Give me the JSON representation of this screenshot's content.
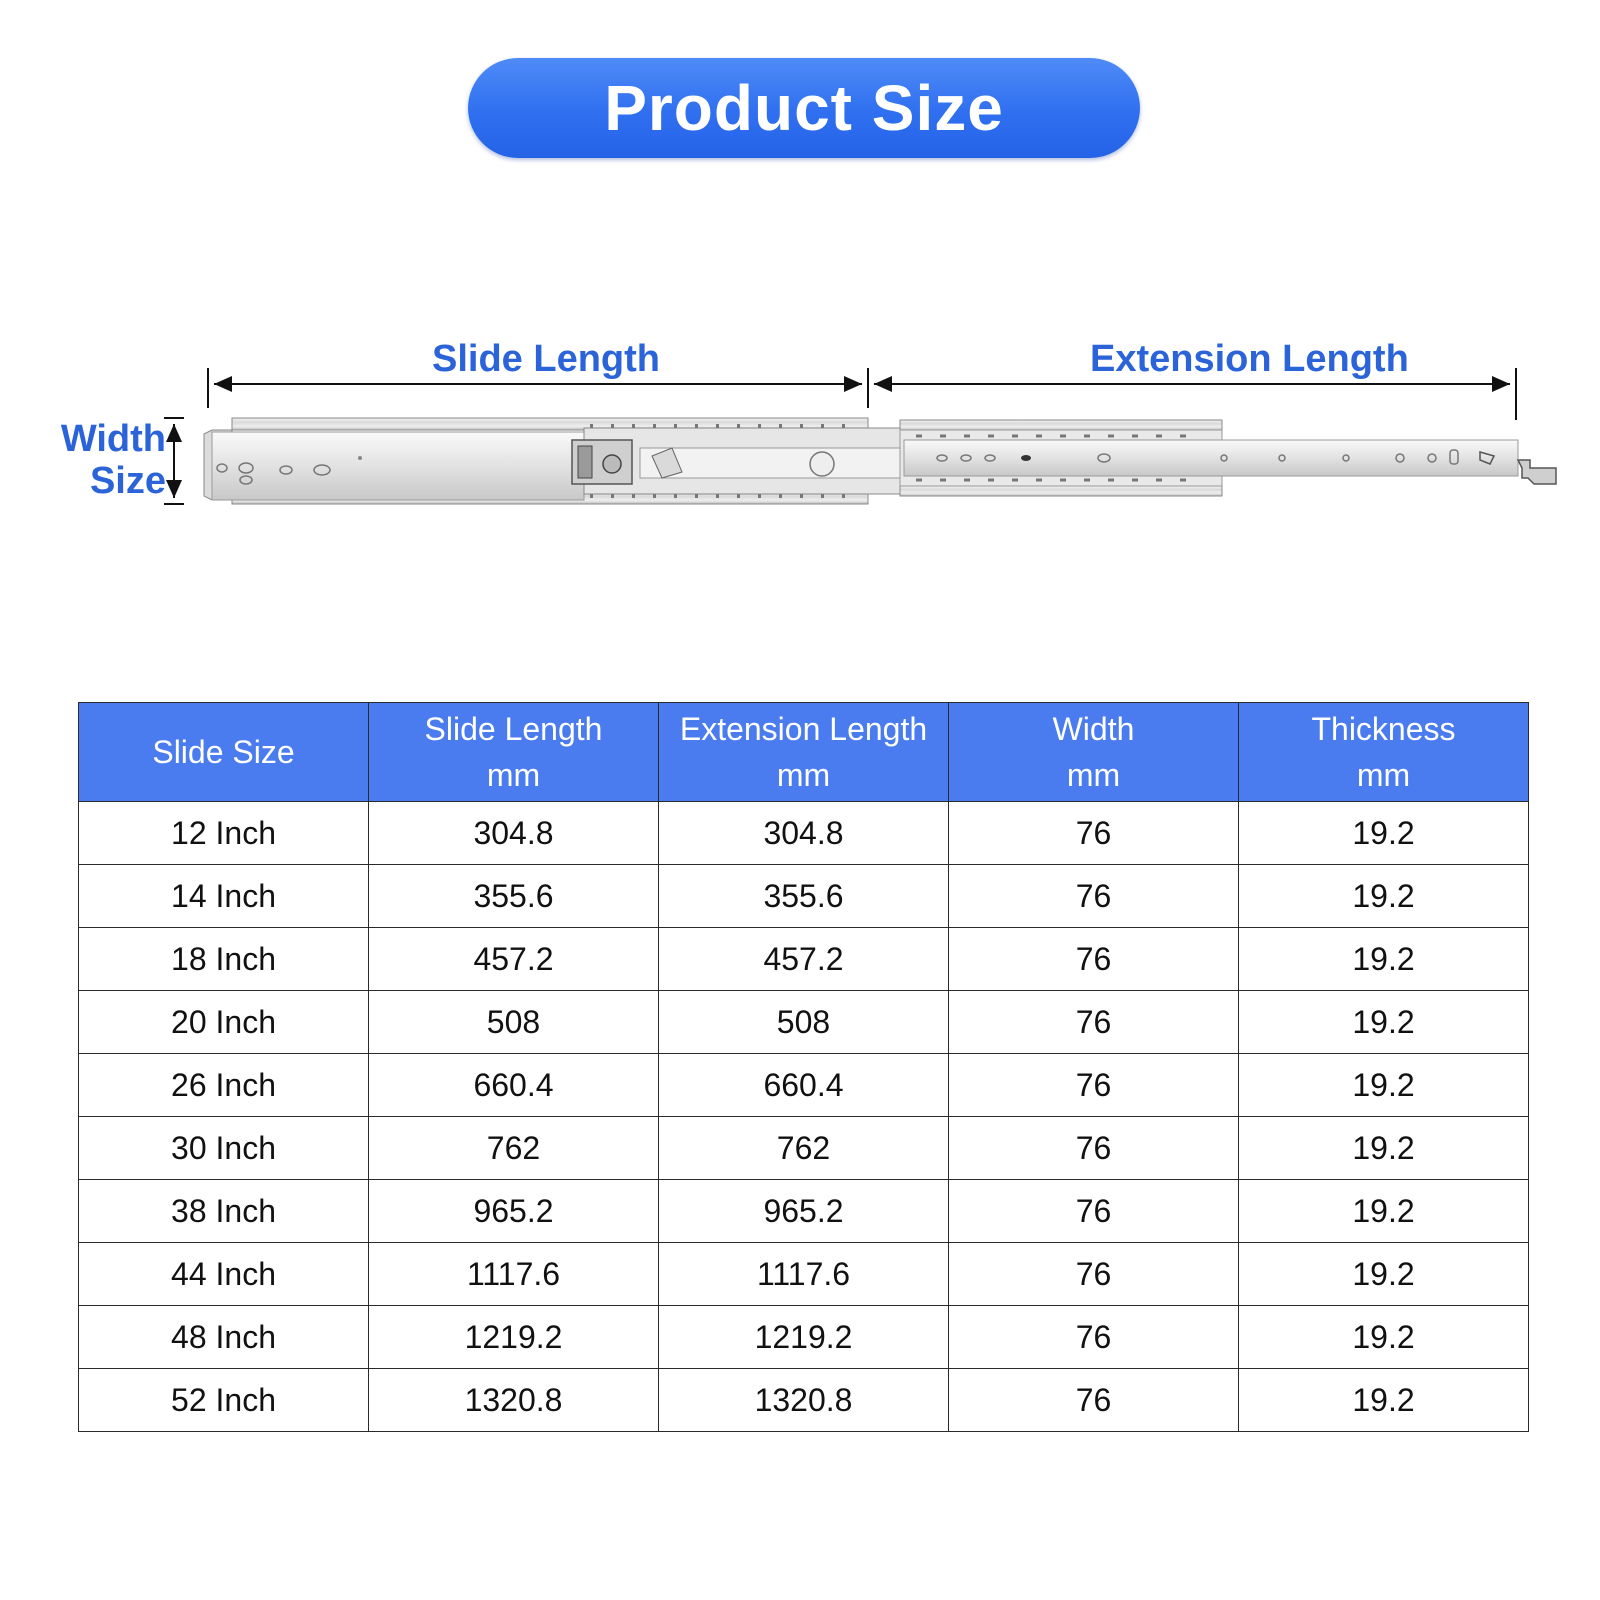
{
  "title": "Product Size",
  "diagram": {
    "slide_length_label": "Slide Length",
    "extension_length_label": "Extension Length",
    "width_label_line1": "Width",
    "width_label_line2": "Size"
  },
  "colors": {
    "accent": "#2b63d9",
    "header_bg": "#4a7cf0",
    "title_pill": "#2f6ff0"
  },
  "table": {
    "headers": [
      {
        "line1": "Slide Size",
        "line2": ""
      },
      {
        "line1": "Slide Length",
        "line2": "mm"
      },
      {
        "line1": "Extension Length",
        "line2": "mm"
      },
      {
        "line1": "Width",
        "line2": "mm"
      },
      {
        "line1": "Thickness",
        "line2": "mm"
      }
    ],
    "rows": [
      [
        "12 Inch",
        "304.8",
        "304.8",
        "76",
        "19.2"
      ],
      [
        "14 Inch",
        "355.6",
        "355.6",
        "76",
        "19.2"
      ],
      [
        "18 Inch",
        "457.2",
        "457.2",
        "76",
        "19.2"
      ],
      [
        "20 Inch",
        "508",
        "508",
        "76",
        "19.2"
      ],
      [
        "26 Inch",
        "660.4",
        "660.4",
        "76",
        "19.2"
      ],
      [
        "30 Inch",
        "762",
        "762",
        "76",
        "19.2"
      ],
      [
        "38 Inch",
        "965.2",
        "965.2",
        "76",
        "19.2"
      ],
      [
        "44 Inch",
        "1117.6",
        "1117.6",
        "76",
        "19.2"
      ],
      [
        "48 Inch",
        "1219.2",
        "1219.2",
        "76",
        "19.2"
      ],
      [
        "52 Inch",
        "1320.8",
        "1320.8",
        "76",
        "19.2"
      ]
    ]
  }
}
